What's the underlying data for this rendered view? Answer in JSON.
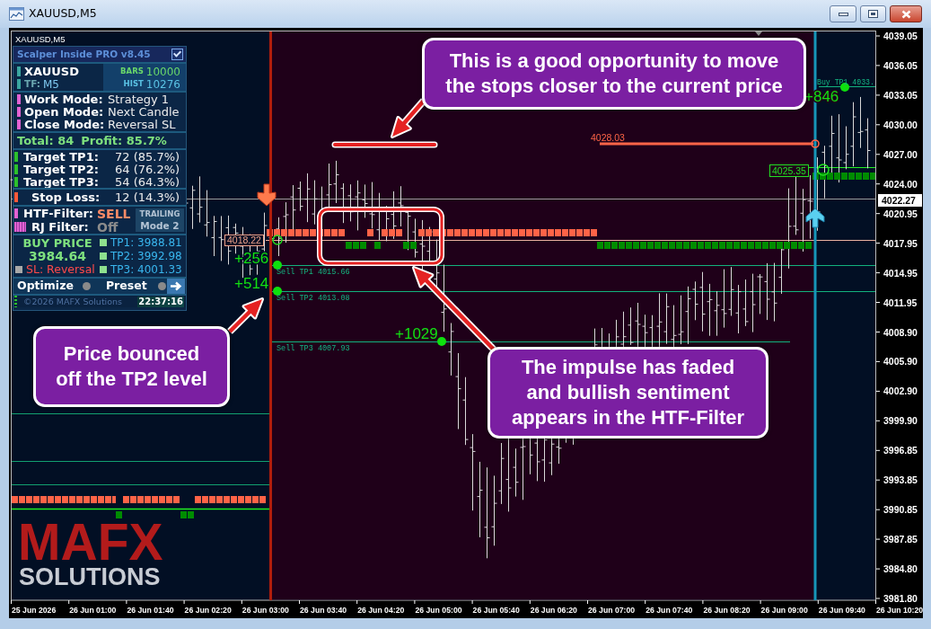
{
  "window": {
    "title": "XAUUSD,M5"
  },
  "chart": {
    "label": "XAUUSD,M5",
    "price_ticks": [
      "4039.05",
      "4036.05",
      "4033.05",
      "4030.00",
      "4027.00",
      "4024.00",
      "4020.95",
      "4017.95",
      "4014.95",
      "4011.95",
      "4008.90",
      "4005.90",
      "4002.90",
      "3999.90",
      "3996.85",
      "3993.85",
      "3990.85",
      "3987.85",
      "3984.80",
      "3981.80"
    ],
    "current_price": "4022.27",
    "time_ticks": [
      "25 Jun 2026",
      "26 Jun 01:00",
      "26 Jun 01:40",
      "26 Jun 02:20",
      "26 Jun 03:00",
      "26 Jun 03:40",
      "26 Jun 04:20",
      "26 Jun 05:00",
      "26 Jun 05:40",
      "26 Jun 06:20",
      "26 Jun 07:00",
      "26 Jun 07:40",
      "26 Jun 08:20",
      "26 Jun 09:00",
      "26 Jun 09:40",
      "26 Jun 10:20"
    ],
    "price_tags": [
      {
        "text": "4018.22",
        "kind": "sell_entry"
      },
      {
        "text": "4028.03",
        "kind": "stop"
      },
      {
        "text": "4025.35",
        "kind": "buy_entry"
      }
    ],
    "target_labels": [
      "Sell TP1 4015.66",
      "Sell TP2 4013.08",
      "Sell TP3 4007.93",
      "Buy TP1 4033."
    ],
    "profits": [
      "+256",
      "+514",
      "+1029",
      "+846"
    ],
    "signals": [
      {
        "kind": "sell"
      },
      {
        "kind": "buy"
      }
    ]
  },
  "panel": {
    "title": "Scalper Inside PRO v8.45",
    "enabled": true,
    "symbol": "XAUUSD",
    "timeframe": {
      "label": "TF:",
      "value": "M5"
    },
    "stats": [
      {
        "label": "BARS",
        "value": "10000"
      },
      {
        "label": "HIST",
        "value": "10276"
      }
    ],
    "modes": [
      {
        "label": "Work Mode:",
        "value": "Strategy 1"
      },
      {
        "label": "Open Mode:",
        "value": "Next Candle"
      },
      {
        "label": "Close Mode:",
        "value": "Reversal SL"
      }
    ],
    "total": "Total: 84",
    "profit": "Profit: 85.7%",
    "targets": [
      {
        "label": "Target TP1:",
        "value": "72 (85.7%)"
      },
      {
        "label": "Target TP2:",
        "value": "64 (76.2%)"
      },
      {
        "label": "Target TP3:",
        "value": "54 (64.3%)"
      }
    ],
    "stop_loss": {
      "label": "Stop Loss:",
      "value": "12 (14.3%)"
    },
    "filters": [
      {
        "label": "HTF-Filter:",
        "value": "SELL",
        "kind": "sell"
      },
      {
        "label": "RJ Filter:",
        "value": "Off",
        "kind": "off"
      }
    ],
    "trailing": {
      "label": "TRAILING",
      "mode": "Mode 2"
    },
    "signal": {
      "label": "BUY PRICE",
      "price": "3984.64",
      "stop": "SL: Reversal",
      "targets": [
        "TP1: 3988.81",
        "TP2: 3992.98",
        "TP3: 4001.33"
      ]
    },
    "actions": [
      {
        "label": "Optimize",
        "on": false
      },
      {
        "label": "Preset",
        "on": false
      }
    ],
    "copyright": "©2026 MAFX Solutions",
    "clock": "22:37:16"
  },
  "callouts": [
    "This is a good opportunity to move the stops closer to the current price",
    "Price bounced off the TP2 level",
    "The impulse has faded and bullish sentiment appears in the HTF-Filter"
  ],
  "logo": {
    "name": "MAFX",
    "tagline": "SOLUTIONS"
  }
}
